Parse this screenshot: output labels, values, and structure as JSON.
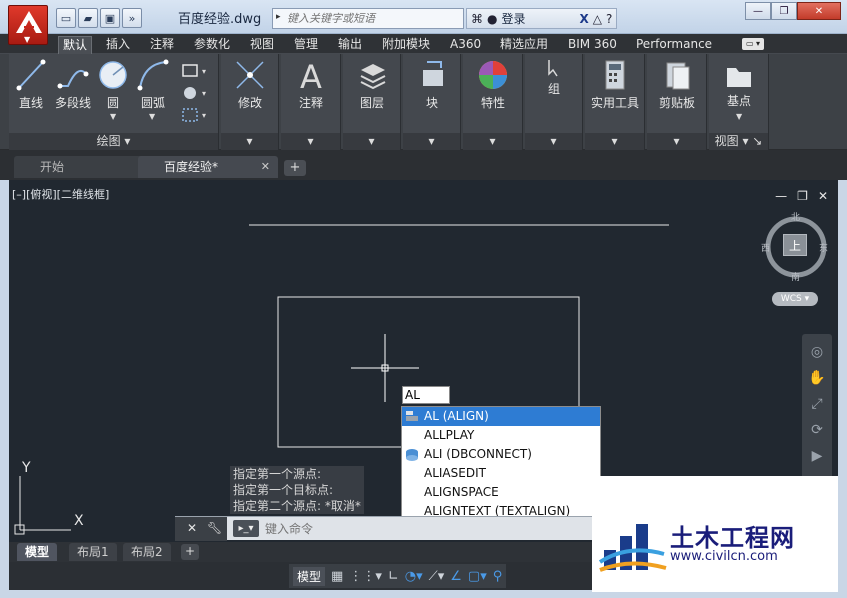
{
  "titlebar": {
    "file_title": "百度经验.dwg",
    "search_placeholder": "键入关键字或短语",
    "login_label": "登录"
  },
  "ribbon": {
    "tabs": [
      "默认",
      "插入",
      "注释",
      "参数化",
      "视图",
      "管理",
      "输出",
      "附加模块",
      "A360",
      "精选应用",
      "BIM 360",
      "Performance"
    ],
    "active_tab": "默认",
    "draw_panel": {
      "title": "绘图",
      "tools": [
        "直线",
        "多段线",
        "圆",
        "圆弧"
      ]
    },
    "panels": [
      "修改",
      "注释",
      "图层",
      "块",
      "特性",
      "组",
      "实用工具",
      "剪贴板",
      "基点"
    ],
    "view_panel_title": "视图"
  },
  "doc_tabs": {
    "start": "开始",
    "current": "百度经验*"
  },
  "viewport": {
    "label": "[–][俯视][二维线框]",
    "viewcube": {
      "north": "北",
      "south": "南",
      "east": "东",
      "west": "西",
      "top": "上"
    },
    "wcs": "WCS",
    "ucs_x": "X",
    "ucs_y": "Y"
  },
  "command_history": [
    "指定第一个源点:",
    "指定第一个目标点:",
    "指定第二个源点: *取消*"
  ],
  "dynamic_input": {
    "value": "AL"
  },
  "autocomplete": {
    "items": [
      "AL (ALIGN)",
      "ALLPLAY",
      "ALI (DBCONNECT)",
      "ALIASEDIT",
      "ALIGNSPACE",
      "ALIGNTEXT (TEXTALIGN)"
    ],
    "selected_index": 0
  },
  "command_line": {
    "placeholder": "键入命令"
  },
  "layout_tabs": [
    "模型",
    "布局1",
    "布局2"
  ],
  "statusbar": {
    "model_label": "模型"
  },
  "watermark": {
    "name": "土木工程网",
    "url": "www.civilcn.com"
  }
}
